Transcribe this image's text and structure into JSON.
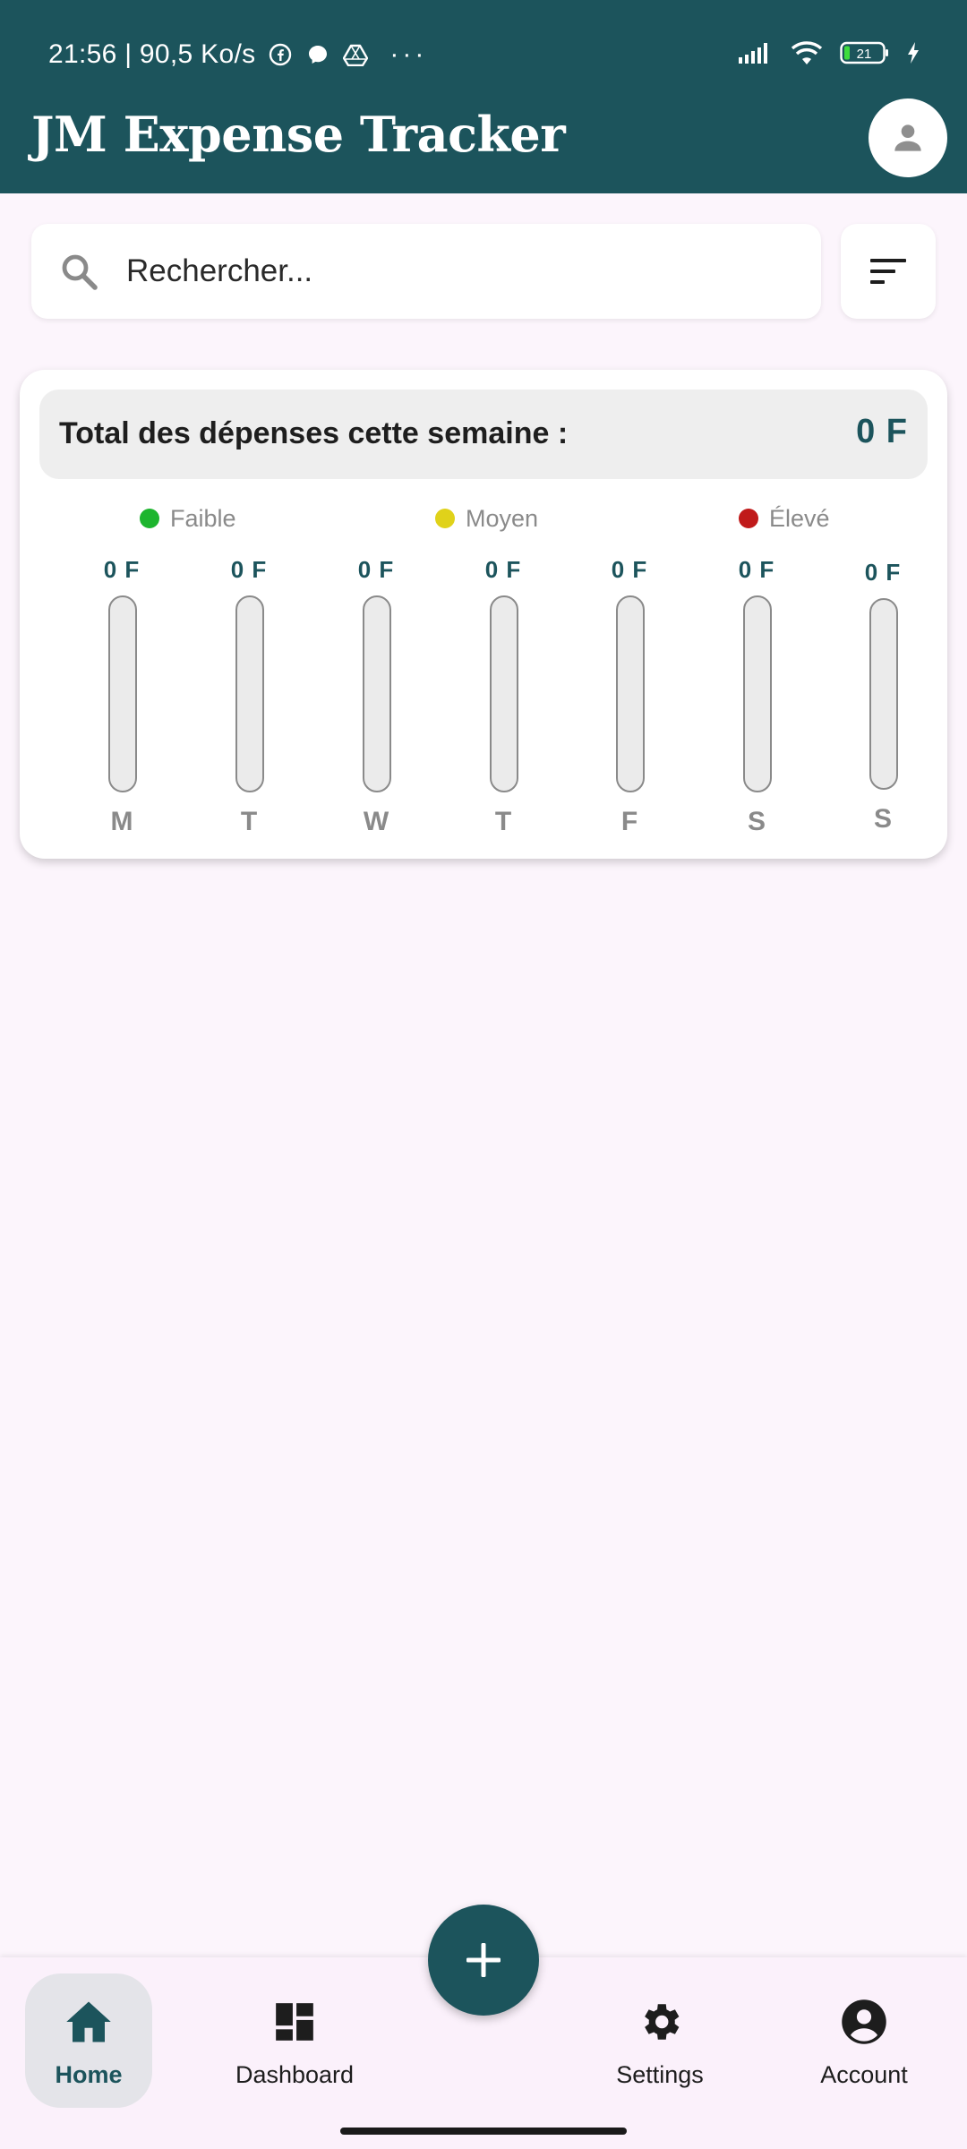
{
  "status_bar": {
    "time_speed": "21:56 | 90,5 Ko/s",
    "battery": "21",
    "icons": [
      "facebook-icon",
      "messenger-icon",
      "drive-icon",
      "more-dots-icon",
      "signal-icon",
      "wifi-icon",
      "battery-icon",
      "charging-icon"
    ]
  },
  "header": {
    "title": "JM Expense Tracker",
    "avatar_icon": "person-icon"
  },
  "search": {
    "placeholder": "Rechercher...",
    "value": ""
  },
  "summary": {
    "total_label": "Total des dépenses cette semaine :",
    "total_value": "0 F",
    "legend": [
      {
        "label": "Faible",
        "color": "#1db52e"
      },
      {
        "label": "Moyen",
        "color": "#e0d21a"
      },
      {
        "label": "Élevé",
        "color": "#c01a1a"
      }
    ],
    "days": [
      {
        "letter": "M",
        "amount": "0 F",
        "fill": 0
      },
      {
        "letter": "T",
        "amount": "0 F",
        "fill": 0
      },
      {
        "letter": "W",
        "amount": "0 F",
        "fill": 0
      },
      {
        "letter": "T",
        "amount": "0 F",
        "fill": 0
      },
      {
        "letter": "F",
        "amount": "0 F",
        "fill": 0
      },
      {
        "letter": "S",
        "amount": "0 F",
        "fill": 0
      },
      {
        "letter": "S",
        "amount": "0 F",
        "fill": 0
      }
    ]
  },
  "nav": {
    "items": [
      {
        "label": "Home",
        "icon": "home-icon",
        "active": true
      },
      {
        "label": "Dashboard",
        "icon": "dashboard-icon",
        "active": false
      },
      {
        "label": "Settings",
        "icon": "gear-icon",
        "active": false
      },
      {
        "label": "Account",
        "icon": "account-circle-icon",
        "active": false
      }
    ],
    "fab_icon": "plus-icon"
  },
  "colors": {
    "primary": "#1c545c",
    "background": "#fcf5fc"
  }
}
